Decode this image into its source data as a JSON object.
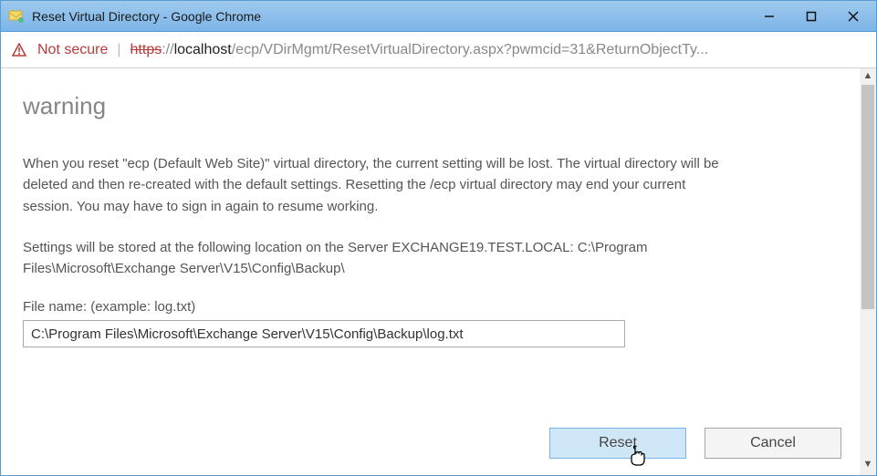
{
  "window": {
    "title": "Reset Virtual Directory - Google Chrome"
  },
  "urlbar": {
    "not_secure": "Not secure",
    "scheme": "https",
    "schemesep": "://",
    "host": "localhost",
    "path": "/ecp/VDirMgmt/ResetVirtualDirectory.aspx?pwmcid=31&ReturnObjectTy..."
  },
  "page": {
    "heading": "warning",
    "para1": "When you reset \"ecp (Default Web Site)\" virtual directory, the current setting will be lost. The virtual directory will be deleted and then re-created with the default settings. Resetting the /ecp virtual directory may end your current session. You may have to sign in again to resume working.",
    "para2": "Settings will be stored at the following location on the Server EXCHANGE19.TEST.LOCAL: C:\\Program Files\\Microsoft\\Exchange Server\\V15\\Config\\Backup\\",
    "file_label": "File name: (example: log.txt)",
    "file_value": "C:\\Program Files\\Microsoft\\Exchange Server\\V15\\Config\\Backup\\log.txt",
    "reset_label": "Reset",
    "cancel_label": "Cancel"
  }
}
